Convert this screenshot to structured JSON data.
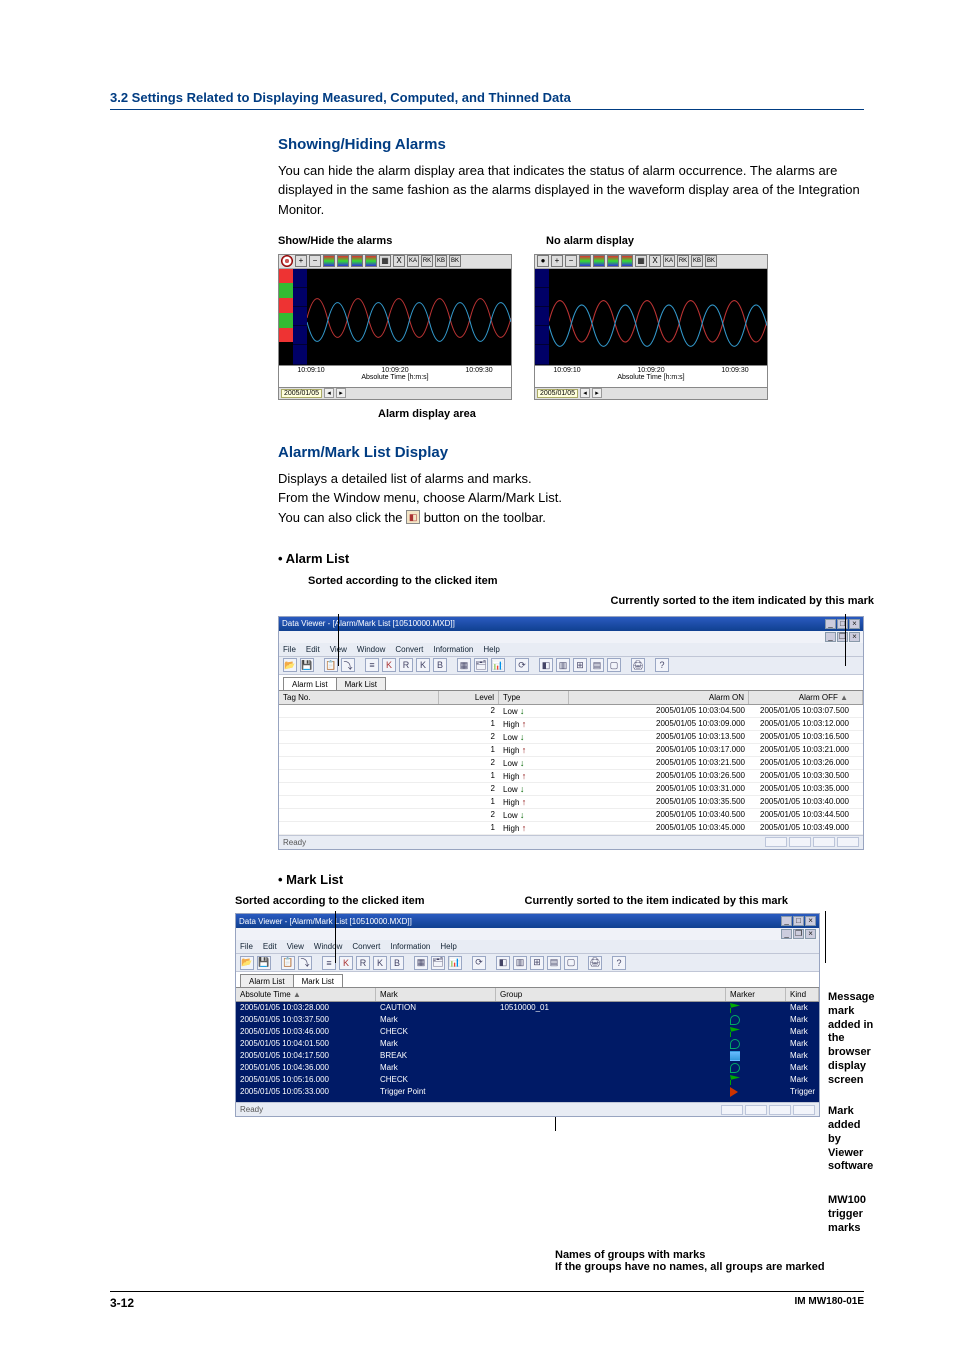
{
  "section_header": "3.2  Settings Related to Displaying Measured, Computed, and Thinned Data",
  "show_hide": {
    "heading": "Showing/Hiding Alarms",
    "para": "You can hide the alarm display area that indicates the status of alarm occurrence. The alarms are displayed in the same fashion as the alarms displayed in the waveform display area of the Integration Monitor.",
    "cap_left": "Show/Hide the alarms",
    "cap_right": "No alarm display",
    "cap_area": "Alarm display area",
    "xticks": [
      "10:09:10",
      "10:09:20",
      "10:09:30"
    ],
    "xaxis": "Absolute Time [h:m:s]",
    "datebox": "2005/01/05"
  },
  "alarm_mark": {
    "heading": "Alarm/Mark List Display",
    "p1": "Displays a detailed list of alarms and marks.",
    "p2": "From the Window menu, choose Alarm/Mark List.",
    "p3a": "You can also click the ",
    "p3b": " button on the toolbar."
  },
  "alarm_list": {
    "bullet": "•  Alarm List",
    "ann_sort": "Sorted according to the clicked item",
    "ann_curr": "Currently sorted to the item indicated by this mark",
    "win_title": "Data Viewer - [Alarm/Mark List [10510000.MXD]]",
    "menus": [
      "File",
      "Edit",
      "View",
      "Window",
      "Convert",
      "Information",
      "Help"
    ],
    "tabs": [
      "Alarm List",
      "Mark List"
    ],
    "cols": [
      "Tag No.",
      "Level",
      "Type",
      "Alarm ON",
      "Alarm OFF"
    ],
    "rows": [
      {
        "lvl": "2",
        "type": "Low",
        "dir": "down",
        "on": "2005/01/05 10:03:04.500",
        "off": "2005/01/05 10:03:07.500"
      },
      {
        "lvl": "1",
        "type": "High",
        "dir": "up",
        "on": "2005/01/05 10:03:09.000",
        "off": "2005/01/05 10:03:12.000"
      },
      {
        "lvl": "2",
        "type": "Low",
        "dir": "down",
        "on": "2005/01/05 10:03:13.500",
        "off": "2005/01/05 10:03:16.500"
      },
      {
        "lvl": "1",
        "type": "High",
        "dir": "up",
        "on": "2005/01/05 10:03:17.000",
        "off": "2005/01/05 10:03:21.000"
      },
      {
        "lvl": "2",
        "type": "Low",
        "dir": "down",
        "on": "2005/01/05 10:03:21.500",
        "off": "2005/01/05 10:03:26.000"
      },
      {
        "lvl": "1",
        "type": "High",
        "dir": "up",
        "on": "2005/01/05 10:03:26.500",
        "off": "2005/01/05 10:03:30.500"
      },
      {
        "lvl": "2",
        "type": "Low",
        "dir": "down",
        "on": "2005/01/05 10:03:31.000",
        "off": "2005/01/05 10:03:35.000"
      },
      {
        "lvl": "1",
        "type": "High",
        "dir": "up",
        "on": "2005/01/05 10:03:35.500",
        "off": "2005/01/05 10:03:40.000"
      },
      {
        "lvl": "2",
        "type": "Low",
        "dir": "down",
        "on": "2005/01/05 10:03:40.500",
        "off": "2005/01/05 10:03:44.500"
      },
      {
        "lvl": "1",
        "type": "High",
        "dir": "up",
        "on": "2005/01/05 10:03:45.000",
        "off": "2005/01/05 10:03:49.000"
      }
    ],
    "status": "Ready"
  },
  "mark_list": {
    "bullet": "•  Mark List",
    "ann_sort": "Sorted according to the clicked item",
    "ann_curr": "Currently sorted to the item indicated by this mark",
    "win_title": "Data Viewer - [Alarm/Mark List [10510000.MXD]]",
    "menus": [
      "File",
      "Edit",
      "View",
      "Window",
      "Convert",
      "Information",
      "Help"
    ],
    "tabs": [
      "Alarm List",
      "Mark List"
    ],
    "cols": [
      "Absolute Time",
      "Mark",
      "Group",
      "Marker",
      "Kind"
    ],
    "rows": [
      {
        "time": "2005/01/05 10:03:28.000",
        "mark": "CAUTION",
        "group": "10510000_01",
        "icon": "flag",
        "kind": "Mark"
      },
      {
        "time": "2005/01/05 10:03:37.500",
        "mark": "Mark",
        "group": "",
        "icon": "mag",
        "kind": "Mark"
      },
      {
        "time": "2005/01/05 10:03:46.000",
        "mark": "CHECK",
        "group": "",
        "icon": "flag",
        "kind": "Mark"
      },
      {
        "time": "2005/01/05 10:04:01.500",
        "mark": "Mark",
        "group": "",
        "icon": "mag",
        "kind": "Mark"
      },
      {
        "time": "2005/01/05 10:04:17.500",
        "mark": "BREAK",
        "group": "",
        "icon": "bar",
        "kind": "Mark"
      },
      {
        "time": "2005/01/05 10:04:36.000",
        "mark": "Mark",
        "group": "",
        "icon": "mag",
        "kind": "Mark"
      },
      {
        "time": "2005/01/05 10:05:16.000",
        "mark": "CHECK",
        "group": "",
        "icon": "flag",
        "kind": "Mark"
      },
      {
        "time": "2005/01/05 10:05:33.000",
        "mark": "Trigger Point",
        "group": "",
        "icon": "trig",
        "kind": "Trigger"
      }
    ],
    "status": "Ready",
    "side1": "Message mark added in the browser display screen",
    "side2a": "Mark added by",
    "side2b": "Viewer software",
    "side3": "MW100 trigger marks",
    "bottom1": "Names of groups with marks",
    "bottom2": "If the groups have no names, all groups are marked"
  },
  "footer": {
    "page": "3-12",
    "doc": "IM MW180-01E"
  }
}
